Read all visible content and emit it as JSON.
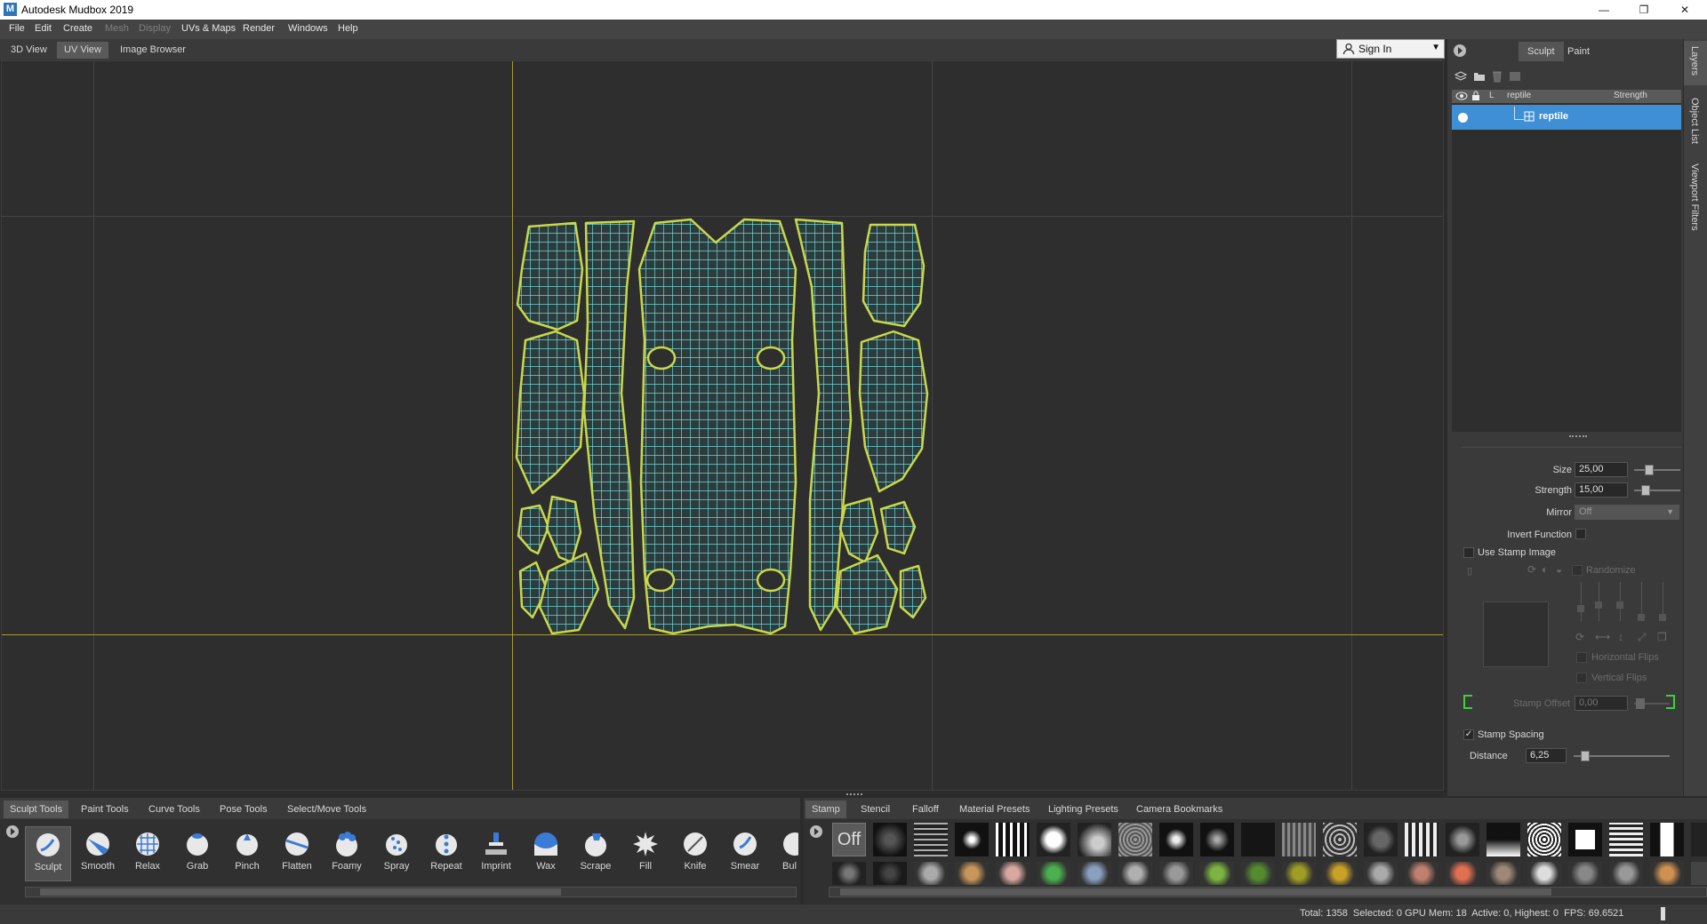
{
  "window": {
    "title": "Autodesk Mudbox 2019",
    "minimize": "—",
    "maximize": "❐",
    "close": "✕"
  },
  "menu": [
    {
      "label": "File",
      "enabled": true
    },
    {
      "label": "Edit",
      "enabled": true
    },
    {
      "label": "Create",
      "enabled": true
    },
    {
      "label": "Mesh",
      "enabled": false
    },
    {
      "label": "Display",
      "enabled": false
    },
    {
      "label": "UVs & Maps",
      "enabled": true
    },
    {
      "label": "Render",
      "enabled": true
    },
    {
      "label": "Windows",
      "enabled": true
    },
    {
      "label": "Help",
      "enabled": true
    }
  ],
  "view_tabs": [
    "3D View",
    "UV View",
    "Image Browser"
  ],
  "active_view_tab": "UV View",
  "sign_in": {
    "label": "Sign In"
  },
  "right_tabs": {
    "sculpt": "Sculpt",
    "paint": "Paint"
  },
  "layers": {
    "header_L": "L",
    "header_name": "reptile",
    "header_strength": "Strength",
    "row_name": "reptile"
  },
  "side_tabs": [
    "Layers",
    "Object List",
    "Viewport Filters"
  ],
  "properties": {
    "size_label": "Size",
    "size_value": "25,00",
    "strength_label": "Strength",
    "strength_value": "15,00",
    "mirror_label": "Mirror",
    "mirror_value": "Off",
    "invert_label": "Invert Function",
    "use_stamp_label": "Use Stamp Image",
    "randomize_label": "Randomize",
    "hflips_label": "Horizontal Flips",
    "vflips_label": "Vertical Flips",
    "stamp_offset_label": "Stamp Offset",
    "stamp_offset_value": "0,00",
    "stamp_spacing_label": "Stamp Spacing",
    "stamp_spacing_checked": "✓",
    "distance_label": "Distance",
    "distance_value": "6,25"
  },
  "tool_tabs": [
    "Sculpt Tools",
    "Paint Tools",
    "Curve Tools",
    "Pose Tools",
    "Select/Move Tools"
  ],
  "active_tool_tab": "Sculpt Tools",
  "tools": [
    "Sculpt",
    "Smooth",
    "Relax",
    "Grab",
    "Pinch",
    "Flatten",
    "Foamy",
    "Spray",
    "Repeat",
    "Imprint",
    "Wax",
    "Scrape",
    "Fill",
    "Knife",
    "Smear",
    "Bul"
  ],
  "active_tool": "Sculpt",
  "stamp_tabs": [
    "Stamp",
    "Stencil",
    "Falloff",
    "Material Presets",
    "Lighting Presets",
    "Camera Bookmarks"
  ],
  "active_stamp_tab": "Stamp",
  "stamp_off_label": "Off",
  "status": "Total: 1358  Selected: 0 GPU Mem: 18  Active: 0, Highest: 0  FPS: 69.6521",
  "colors": {
    "uv_fill": "#68d6d8",
    "uv_border": "#c8d84a",
    "selection": "#3f8fd6",
    "axis": "#a89a3a"
  }
}
